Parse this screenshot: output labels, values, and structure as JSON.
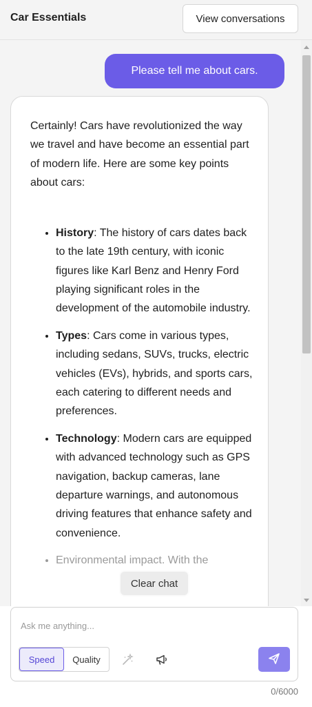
{
  "header": {
    "title": "Car Essentials",
    "view_conversations_label": "View conversations"
  },
  "messages": {
    "user_message": "Please tell me about cars.",
    "assistant": {
      "intro": "Certainly! Cars have revolutionized the way we travel and have become an essential part of modern life. Here are some key points about cars:",
      "points": [
        {
          "term": "History",
          "text": ": The history of cars dates back to the late 19th century, with iconic figures like Karl Benz and Henry Ford playing significant roles in the development of the automobile industry."
        },
        {
          "term": "Types",
          "text": ": Cars come in various types, including sedans, SUVs, trucks, electric vehicles (EVs), hybrids, and sports cars, each catering to different needs and preferences."
        },
        {
          "term": "Technology",
          "text": ": Modern cars are equipped with advanced technology such as GPS navigation, backup cameras, lane departure warnings, and autonomous driving features that enhance safety and convenience."
        },
        {
          "term": "Environmental impact",
          "text": ". With the"
        }
      ]
    }
  },
  "clear_chat_label": "Clear chat",
  "composer": {
    "placeholder": "Ask me anything...",
    "mode_speed_label": "Speed",
    "mode_quality_label": "Quality",
    "selected_mode": "Speed",
    "char_count": "0/6000"
  },
  "icons": {
    "enhance": "magic-wand-icon",
    "announce": "megaphone-icon",
    "send": "send-icon"
  },
  "colors": {
    "accent": "#6b5ce7",
    "send_button": "#8b82ee",
    "background": "#f4f4f4"
  }
}
